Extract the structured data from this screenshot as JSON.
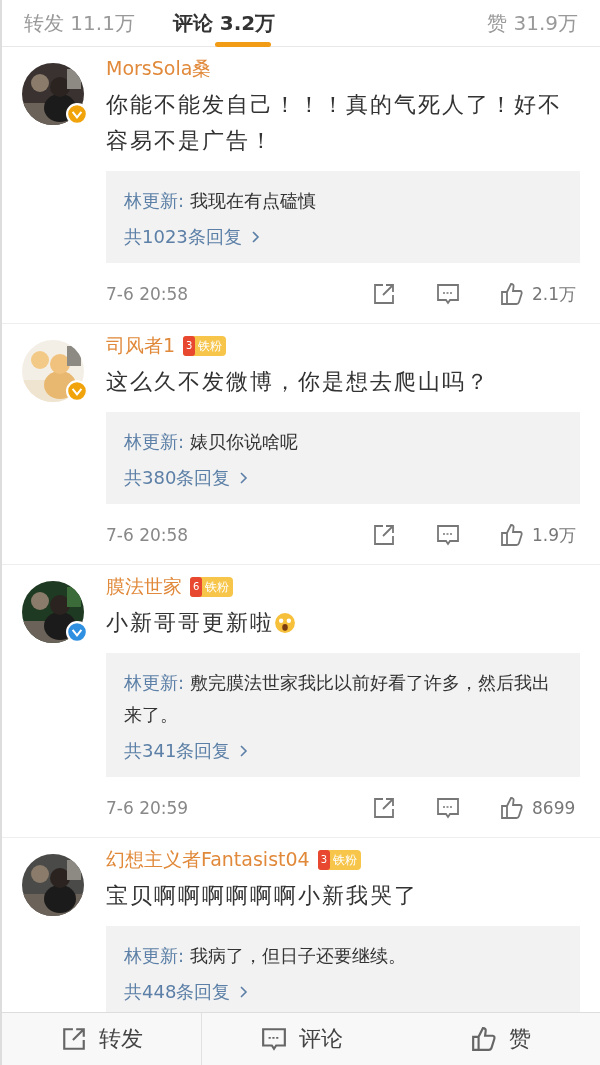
{
  "tabs": [
    {
      "label": "转发 11.1万",
      "selected": false
    },
    {
      "label": "评论 3.2万",
      "selected": true
    },
    {
      "label": "赞 31.9万",
      "selected": false
    }
  ],
  "comments": [
    {
      "verified_badge": {
        "color": "#f0a30a"
      },
      "name": "MorsSola桑",
      "text": "你能不能发自己！！！真的气死人了！好不容易不是广告！",
      "reply": {
        "author": "林更新:",
        "text": "我现在有点磕慎"
      },
      "reply_count": "共1023条回复",
      "date": "7-6 20:58",
      "likes": "2.1万"
    },
    {
      "verified_badge": {
        "color": "#f0a30a"
      },
      "name": "司风者1",
      "badge": {
        "level": "3",
        "label": "铁粉"
      },
      "text": "这么久不发微博，你是想去爬山吗？",
      "reply": {
        "author": "林更新:",
        "text": "婊贝你说啥呢"
      },
      "reply_count": "共380条回复",
      "date": "7-6 20:58",
      "likes": "1.9万"
    },
    {
      "verified_badge": {
        "color": "#2f8fe0"
      },
      "name": "膜法世家",
      "badge": {
        "level": "6",
        "label": "铁粉"
      },
      "text": "小新哥哥更新啦",
      "emoji": true,
      "reply": {
        "author": "林更新:",
        "text": "敷完膜法世家我比以前好看了许多，然后我出来了。"
      },
      "reply_count": "共341条回复",
      "date": "7-6 20:59",
      "likes": "8699"
    },
    {
      "name": "幻想主义者Fantasist04",
      "badge": {
        "level": "3",
        "label": "铁粉"
      },
      "text": "宝贝啊啊啊啊啊啊小新我哭了",
      "reply": {
        "author": "林更新:",
        "text": "我病了，但日子还要继续。"
      },
      "reply_count": "共448条回复"
    }
  ],
  "actions": [
    {
      "kind": "repost",
      "label": "转发"
    },
    {
      "kind": "comment",
      "label": "评论"
    },
    {
      "kind": "like",
      "label": "赞"
    }
  ]
}
